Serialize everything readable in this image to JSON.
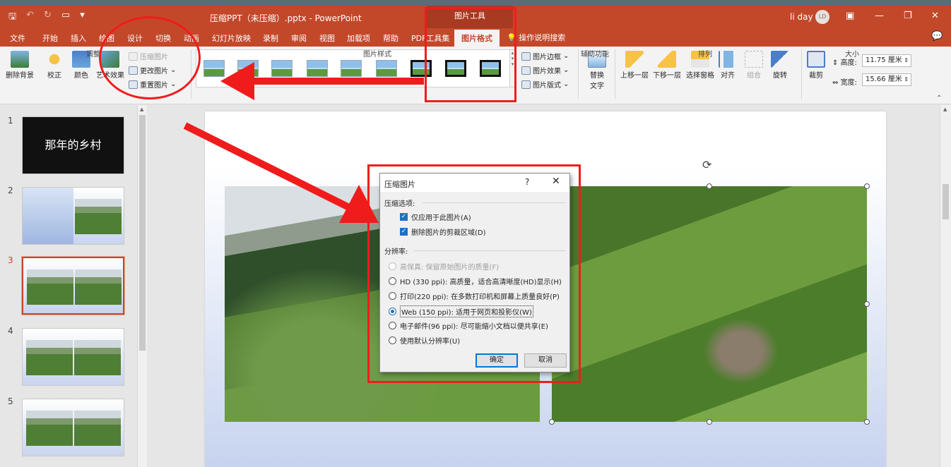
{
  "titlebar": {
    "doc_title": "压缩PPT（未压缩）.pptx - PowerPoint",
    "context_title": "图片工具",
    "user": "li day",
    "avatar_initials": "LD"
  },
  "tabs": [
    "文件",
    "开始",
    "插入",
    "绘图",
    "设计",
    "切换",
    "动画",
    "幻灯片放映",
    "录制",
    "审阅",
    "视图",
    "加载项",
    "帮助",
    "PDF工具集",
    "图片格式"
  ],
  "tell_me": "操作说明搜索",
  "ribbon": {
    "adjust": {
      "remove_bg": "删除背景",
      "corrections": "校正",
      "color": "颜色",
      "artistic": "艺术效果",
      "compress": "压缩图片",
      "change": "更改图片",
      "reset": "重置图片",
      "group_label": "调整"
    },
    "styles": {
      "border": "图片边框",
      "effects": "图片效果",
      "layout": "图片版式",
      "group_label": "图片样式"
    },
    "accessibility": {
      "alt_text": "替换文字",
      "group_label": "辅助功能"
    },
    "arrange": {
      "forward": "上移一层",
      "backward": "下移一层",
      "selection": "选择窗格",
      "align": "对齐",
      "group": "组合",
      "rotate": "旋转",
      "group_label": "排列"
    },
    "size": {
      "crop": "裁剪",
      "height_label": "高度:",
      "height_value": "11.75 厘米",
      "width_label": "宽度:",
      "width_value": "15.66 厘米",
      "group_label": "大小"
    }
  },
  "slides": {
    "numbers": [
      "1",
      "2",
      "3",
      "4",
      "5"
    ],
    "slide1_text": "那年的乡村"
  },
  "dialog": {
    "title": "压缩图片",
    "help": "?",
    "close": "✕",
    "compression_label": "压缩选项:",
    "opt_apply_only": "仅应用于此图片(A)",
    "opt_delete_cropped": "删除图片的剪裁区域(D)",
    "resolution_label": "分辨率:",
    "res_hifi": "高保真: 保留原始图片的质量(F)",
    "res_hd": "HD (330 ppi): 高质量，适合高清晰度(HD)显示(H)",
    "res_print": "打印(220 ppi): 在多数打印机和屏幕上质量良好(P)",
    "res_web": "Web (150 ppi): 适用于网页和投影仪(W)",
    "res_email": "电子邮件(96 ppi): 尽可能缩小文档以便共享(E)",
    "res_default": "使用默认分辨率(U)",
    "ok": "确定",
    "cancel": "取消"
  },
  "colors": {
    "accent": "#c3482a",
    "annotation": "#f01c1c",
    "selection_blue": "#1f6fc5"
  }
}
